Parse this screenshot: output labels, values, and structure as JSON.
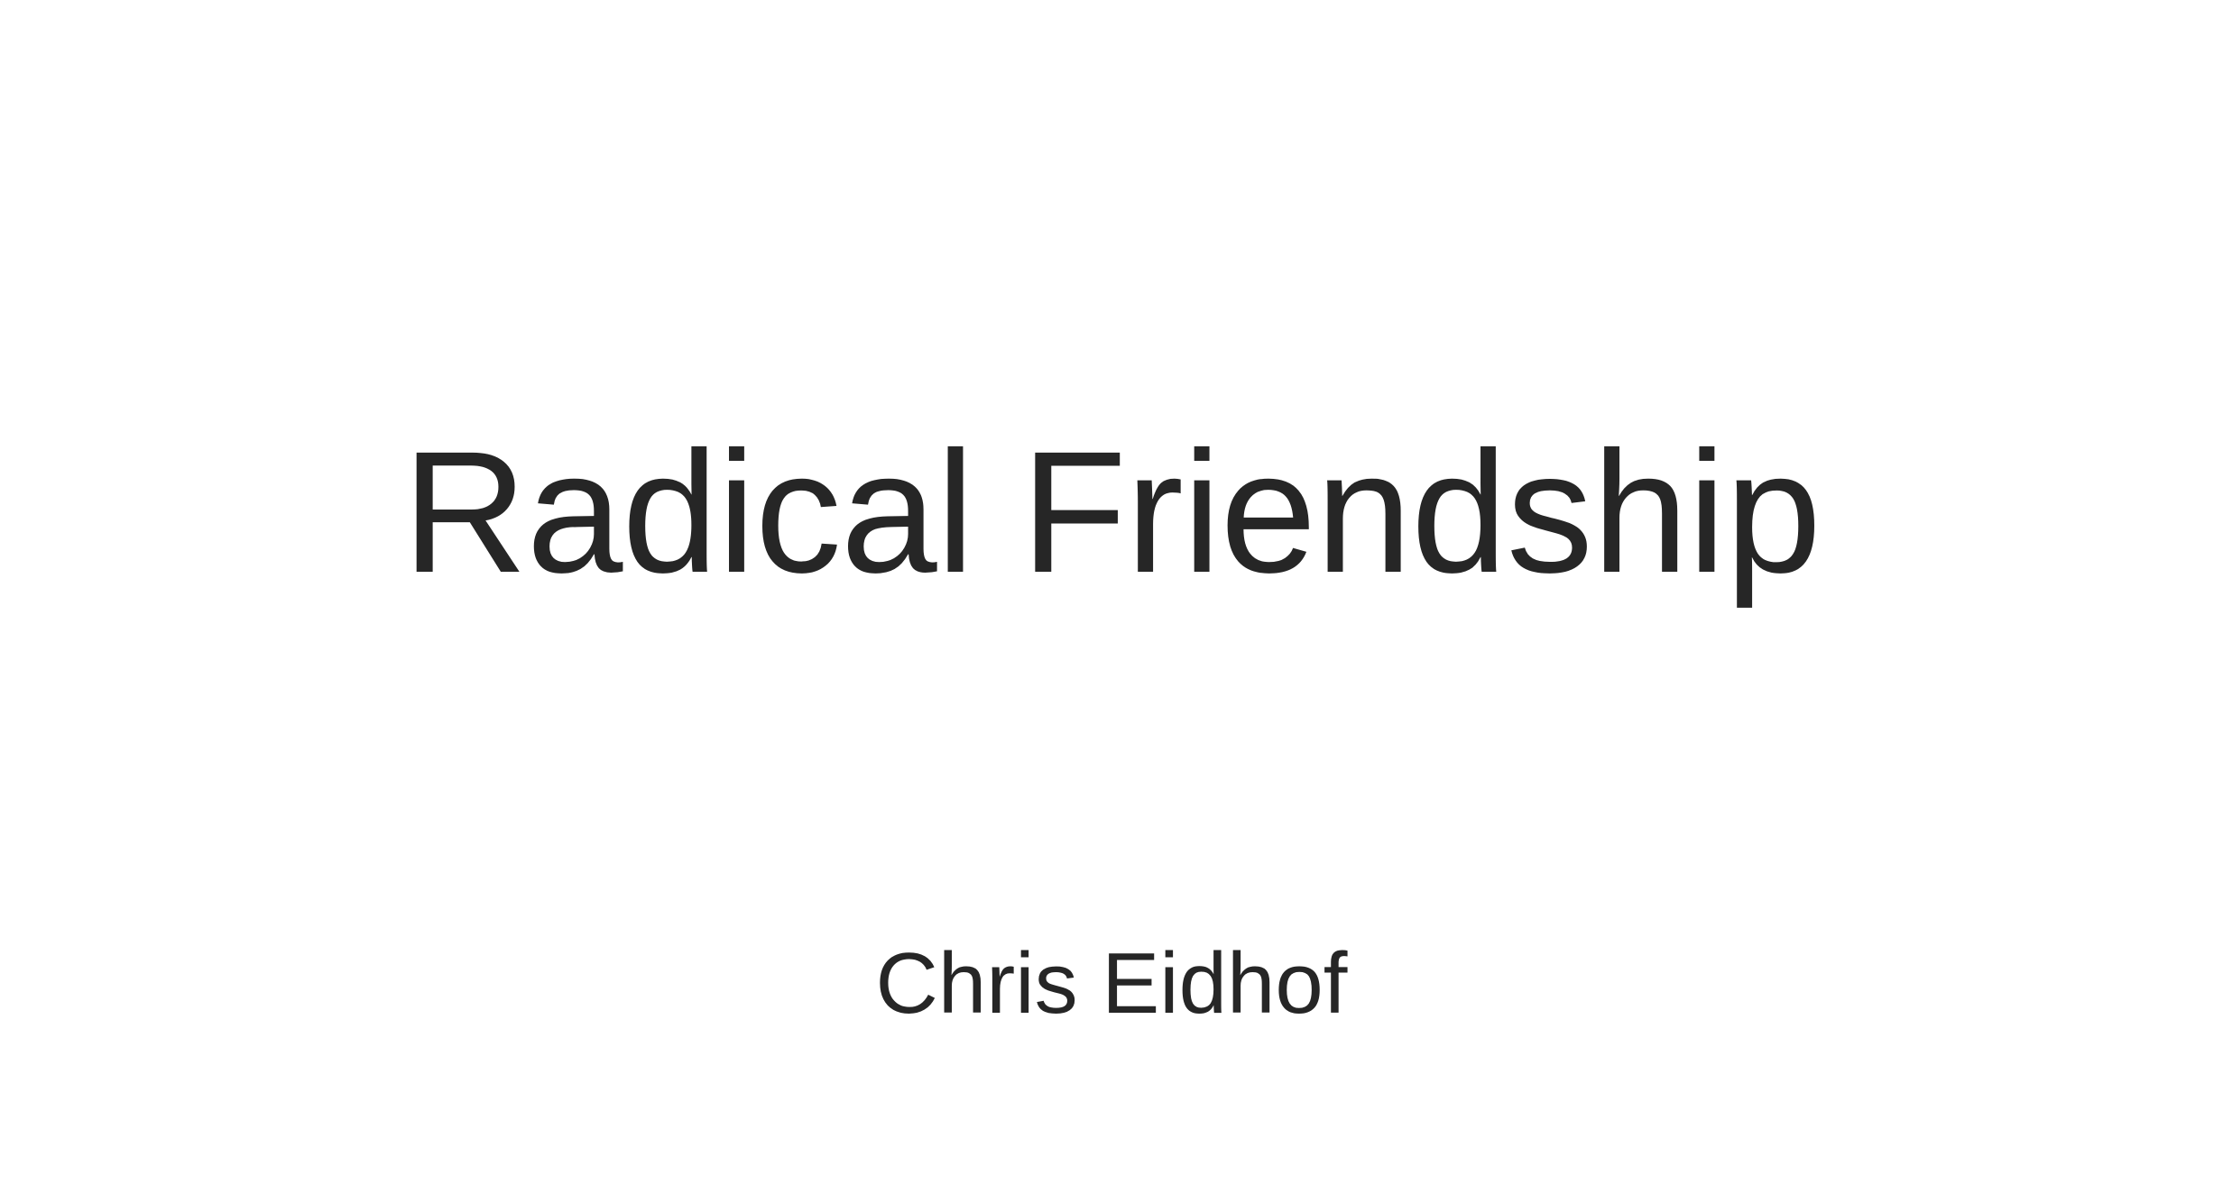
{
  "slide": {
    "title": "Radical Friendship",
    "author": "Chris Eidhof",
    "text_color": "#262626",
    "background_color": "#ffffff"
  }
}
